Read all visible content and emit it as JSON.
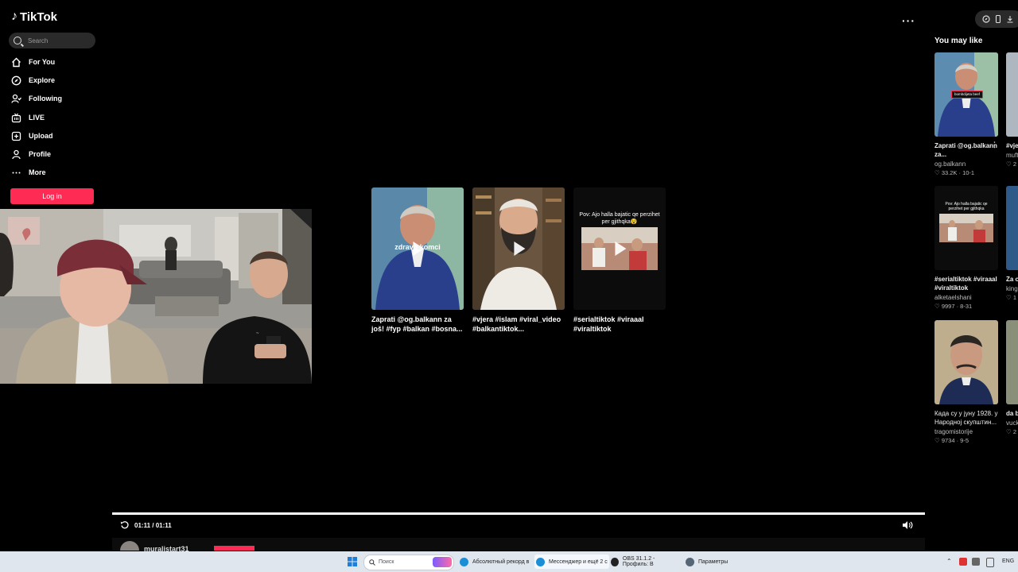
{
  "app": {
    "logo": "TikTok"
  },
  "sidebar": {
    "search_placeholder": "Search",
    "items": [
      {
        "label": "For You",
        "icon": "home-icon"
      },
      {
        "label": "Explore",
        "icon": "compass-icon"
      },
      {
        "label": "Following",
        "icon": "following-icon"
      },
      {
        "label": "LIVE",
        "icon": "live-icon"
      },
      {
        "label": "Upload",
        "icon": "upload-icon"
      },
      {
        "label": "Profile",
        "icon": "profile-icon"
      },
      {
        "label": "More",
        "icon": "more-icon"
      }
    ],
    "login_label": "Log in"
  },
  "videos": [
    {
      "caption": "Zaprati @og.balkann za još! #fyp #balkan #bosna...",
      "overlay": "zdravo komci"
    },
    {
      "caption": "#vjera #islam #viral_video #balkantiktok...",
      "overlay": ""
    },
    {
      "caption": "#serialtiktok #viraaal #viraltiktok",
      "overlay": "Pov: Ajo halla bajatic qe perzihet per gjithqka😵"
    }
  ],
  "player": {
    "time": "01:11 / 01:11",
    "progress": 1.0,
    "username": "muralistart31"
  },
  "you_may_like": {
    "title": "You may like",
    "items": [
      {
        "caption": "Zaprati @og.balkann za...",
        "author": "og.balkann",
        "stats": "33.2K · 10-1",
        "badge": "bombdijeta beef"
      },
      {
        "caption": "#serialtiktok #viraaal #viraltiktok",
        "author": "alketaelshani",
        "stats": "9997 · 8-31",
        "overlay": "Pov: Ajo halla bajatic qe perzihet per gjithqka"
      },
      {
        "caption": "Када су у јуну 1928. у Народној скупштин...",
        "author": "tragomistorije",
        "stats": "9734 · 9-5"
      }
    ],
    "partial": [
      {
        "caption": "#vje #vir",
        "author": "muft",
        "stats": "2"
      },
      {
        "caption": "Za c krat",
        "author": "king",
        "stats": "1"
      },
      {
        "caption": "da b men",
        "author": "vuck",
        "stats": "2"
      }
    ]
  },
  "taskbar": {
    "search_placeholder": "Поиск",
    "apps": [
      {
        "label": "Абсолютный рекорд в",
        "color": "#1a8fd8"
      },
      {
        "label": "Мессенджер и ещё 2 с",
        "color": "#1a8fd8"
      },
      {
        "label": "OBS 31.1.2 - Профиль: В",
        "color": "#222222"
      },
      {
        "label": "Параметры",
        "color": "#556677"
      }
    ],
    "lang": "ENG"
  }
}
